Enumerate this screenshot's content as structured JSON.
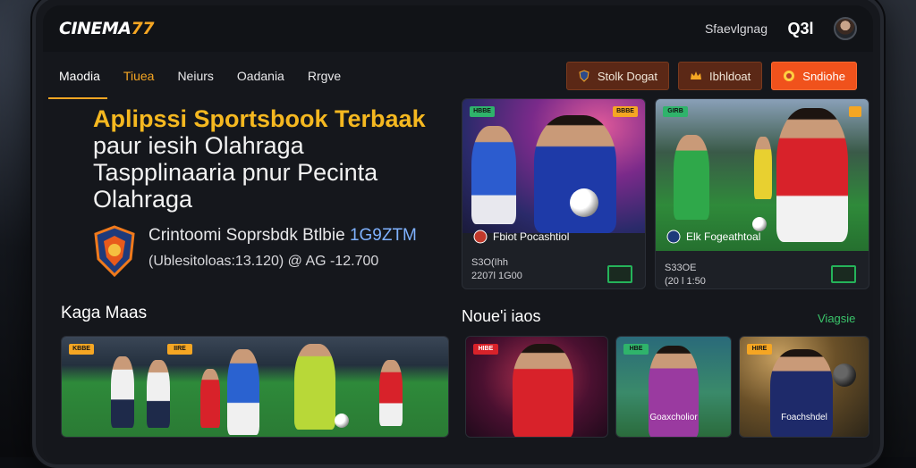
{
  "app": {
    "logo_main": "CINEMA",
    "logo_accent": "77"
  },
  "topbar": {
    "user_name": "Sfaevlgnag",
    "coin_label": "Q3l"
  },
  "nav": {
    "items": [
      "Maodia",
      "Tiuea",
      "Neiurs",
      "Oadania",
      "Rrgve"
    ],
    "buttons": [
      "Stolk Dogat",
      "Ibhldoat",
      "Sndiohe"
    ]
  },
  "hero": {
    "line1": "Aplipssi Sportsbook Terbaak",
    "line2": "paur iesih Olahraga",
    "line3": "Taspplinaaria pnur Pecinta",
    "line4": "Olahraga",
    "badge_title": "Crintoomi Soprsbdk Btlbie ",
    "badge_title_blue": "1G9ZTM",
    "badge_sub": "(Ublesitoloas:13.120) @ AG -12.700"
  },
  "featured": [
    {
      "tag_l": "HBBE",
      "tag_r": "BBBE",
      "title": "Fbiot Pocashtiol",
      "meta1": "S3O(Ihh",
      "meta2": "2207l  1G00"
    },
    {
      "tag_l": "GIRB",
      "tag_r": "",
      "title": "Elk Fogeathtoal",
      "meta1": "S33OE",
      "meta2": "(20 l  1:50"
    }
  ],
  "sections": {
    "left_title": "Kaga Maas",
    "right_title": "Noue'i iaos",
    "view_all": "Viagsie"
  },
  "small_cards": [
    {
      "title": "",
      "tag_l": "KBBE",
      "tag_r": "IIRE"
    },
    {
      "title": "",
      "tag_l": "HIBE",
      "tag_r": ""
    },
    {
      "title": "Goaxcholior",
      "tag_l": "HBE",
      "tag_r": ""
    },
    {
      "title": "Foachshdel",
      "tag_l": "HIRE",
      "tag_r": ""
    }
  ],
  "colors": {
    "accent": "#f5a623",
    "cta": "#f0521c",
    "green": "#25b35a"
  }
}
